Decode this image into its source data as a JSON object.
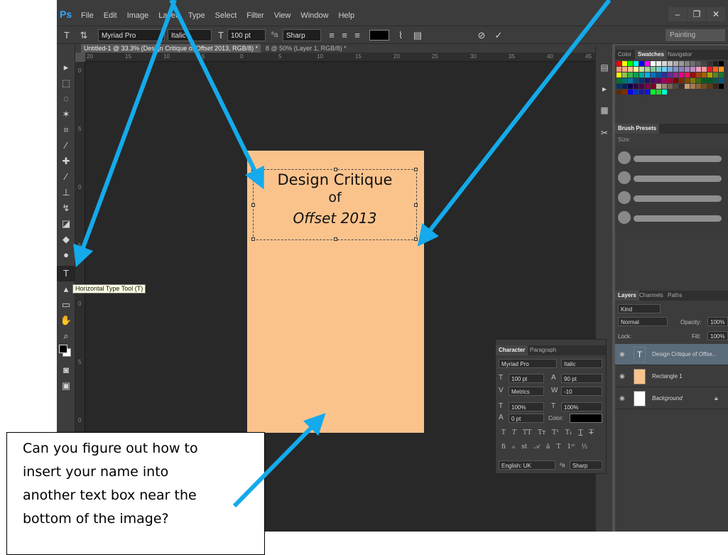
{
  "app": {
    "logo": "Ps",
    "menu": [
      "File",
      "Edit",
      "Image",
      "Layer",
      "Type",
      "Select",
      "Filter",
      "View",
      "Window",
      "Help"
    ],
    "workspace": "Painting"
  },
  "options_bar": {
    "font_family": "Myriad Pro",
    "font_style": "Italic",
    "font_size": "100 pt",
    "antialias_label": "ªa",
    "antialias": "Sharp"
  },
  "tabs": [
    {
      "label": "Untitled-1 @ 33.3% (Design Critique of Offset 2013, RGB/8) *"
    },
    {
      "label": "8 @ 50% (Layer 1, RGB/8) *"
    }
  ],
  "rulers": {
    "h": [
      "20",
      "15",
      "10",
      "5",
      "0",
      "5",
      "10",
      "15",
      "20",
      "25",
      "30",
      "35",
      "40",
      "45"
    ],
    "v": [
      "0",
      "5",
      "0",
      "5",
      "0",
      "5",
      "0",
      "5"
    ]
  },
  "canvas": {
    "doc_color": "#fbc38c",
    "title_line1": "Design Critique",
    "title_line2": "of",
    "title_line3": "Offset 2013"
  },
  "tooltip": "Horizontal Type Tool (T)",
  "swatch_panel": {
    "tabs": [
      "Color",
      "Swatches",
      "Navigator"
    ]
  },
  "brush_panel": {
    "tabs": [
      "Brush Presets"
    ],
    "size_label": "Size:"
  },
  "layers_panel": {
    "tabs": [
      "Layers",
      "Channels",
      "Paths"
    ],
    "kind_label": "Kind",
    "blend_mode": "Normal",
    "opacity_label": "Opacity:",
    "opacity": "100%",
    "lock_label": "Lock:",
    "fill_label": "Fill:",
    "fill": "100%",
    "layers": [
      {
        "name": "Design Critique of Offse...",
        "type": "text"
      },
      {
        "name": "Rectangle 1",
        "type": "shape"
      },
      {
        "name": "Background",
        "type": "background"
      }
    ]
  },
  "character_panel": {
    "tabs": [
      "Character",
      "Paragraph"
    ],
    "font_family": "Myriad Pro",
    "font_style": "Italic",
    "font_size": "100 pt",
    "leading": "90 pt",
    "kerning": "Metrics",
    "tracking": "-10",
    "vertical_scale": "100%",
    "horizontal_scale": "100%",
    "baseline_shift": "0 pt",
    "color_label": "Color:",
    "language": "English: UK",
    "antialias_label": "ªa",
    "antialias": "Sharp"
  },
  "caption_lines": [
    "Can you figure out how to",
    "insert your name into",
    "another text box near the",
    "bottom of the image?"
  ],
  "arrow_color": "#14aaeb"
}
